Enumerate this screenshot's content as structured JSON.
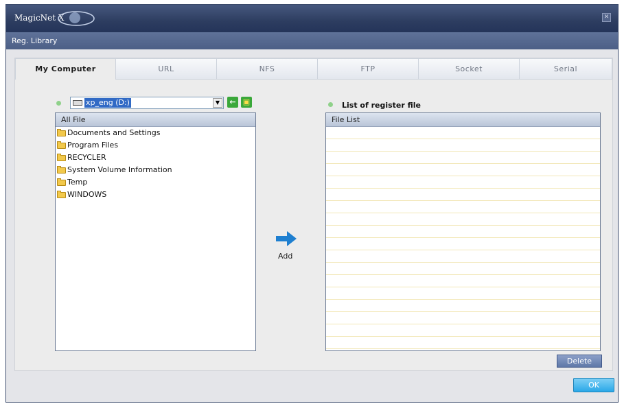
{
  "window": {
    "app_title": "MagicNet X",
    "subtitle": "Reg. Library",
    "close_glyph": "✕"
  },
  "tabs": [
    {
      "label": "My Computer",
      "active": true
    },
    {
      "label": "URL",
      "active": false
    },
    {
      "label": "NFS",
      "active": false
    },
    {
      "label": "FTP",
      "active": false
    },
    {
      "label": "Socket",
      "active": false
    },
    {
      "label": "Serial",
      "active": false
    }
  ],
  "left": {
    "drive_selected": "xp_eng (D:)",
    "drive_icon": "drive-icon",
    "back_icon": "arrow-left-icon",
    "up_folder_icon": "folder-up-icon",
    "list_header": "All File",
    "items": [
      "Documents and Settings",
      "Program Files",
      "RECYCLER",
      "System Volume Information",
      "Temp",
      "WINDOWS"
    ]
  },
  "middle": {
    "add_label": "Add",
    "add_icon": "arrow-right-icon"
  },
  "right": {
    "title": "List of register file",
    "list_header": "File List",
    "items": [],
    "delete_label": "Delete"
  },
  "footer": {
    "ok_label": "OK"
  },
  "colors": {
    "titlebar": "#2d3d60",
    "status_dot": "#8fd18a",
    "ok_button": "#2aa8e8",
    "add_arrow": "#1e7fd0"
  }
}
